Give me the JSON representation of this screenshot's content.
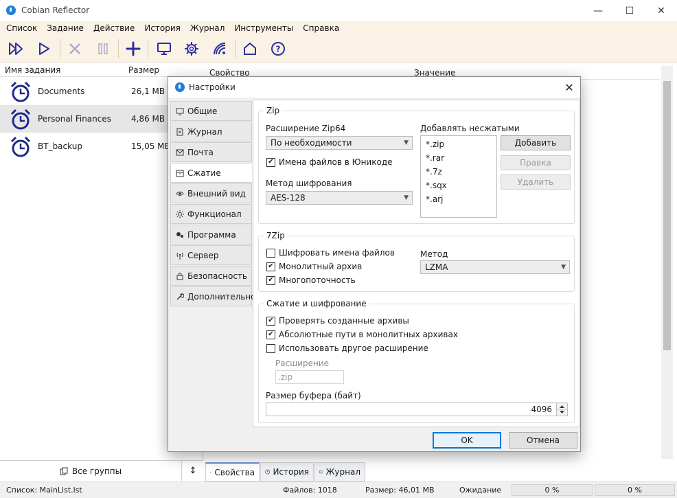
{
  "app": {
    "title": "Cobian Reflector"
  },
  "window_controls": {
    "minimize": "—",
    "maximize": "☐",
    "close": "✕"
  },
  "menu": [
    "Список",
    "Задание",
    "Действие",
    "История",
    "Журнал",
    "Инструменты",
    "Справка"
  ],
  "toolbar": {
    "icons": [
      "run-all-icon",
      "run-icon",
      "stop-icon",
      "pause-icon",
      "add-icon",
      "computer-icon",
      "settings-icon",
      "network-icon",
      "home-icon",
      "help-icon"
    ],
    "accent": "#2d2f9e"
  },
  "task_list": {
    "col_name": "Имя задания",
    "col_size": "Размер",
    "rows": [
      {
        "name": "Documents",
        "size": "26,1 MB"
      },
      {
        "name": "Personal Finances",
        "size": "4,86 MB"
      },
      {
        "name": "BT_backup",
        "size": "15,05 MB"
      }
    ],
    "group_button": "Все группы",
    "sort_icon": "↕"
  },
  "properties": {
    "col_property": "Свойство",
    "col_value": "Значение",
    "tabs": [
      "Свойства",
      "История",
      "Журнал"
    ]
  },
  "status_bar": {
    "list": "Список: MainList.lst",
    "files": "Файлов: 1018",
    "size": "Размер: 46,01 MB",
    "state": "Ожидание",
    "progress1": "0 %",
    "progress2": "0 %"
  },
  "dialog": {
    "title": "Настройки",
    "close_icon": "✕",
    "tabs": [
      {
        "label": "Общие",
        "icon": "monitor-icon"
      },
      {
        "label": "Журнал",
        "icon": "document-icon"
      },
      {
        "label": "Почта",
        "icon": "mail-icon"
      },
      {
        "label": "Сжатие",
        "icon": "archive-icon"
      },
      {
        "label": "Внешний вид",
        "icon": "eye-icon"
      },
      {
        "label": "Функционал",
        "icon": "sun-icon"
      },
      {
        "label": "Программа",
        "icon": "gears-icon"
      },
      {
        "label": "Сервер",
        "icon": "antenna-icon"
      },
      {
        "label": "Безопасность",
        "icon": "lock-icon"
      },
      {
        "label": "Дополнительно",
        "icon": "wrench-icon"
      }
    ],
    "active_tab": 3,
    "zip": {
      "group_title": "Zip",
      "zip64_label": "Расширение Zip64",
      "zip64_value": "По необходимости",
      "unicode_label": "Имена файлов в Юникоде",
      "unicode_checked": true,
      "encryption_label": "Метод шифрования",
      "encryption_value": "AES-128",
      "uncompressed_label": "Добавлять несжатыми",
      "uncompressed_items": [
        "*.zip",
        "*.rar",
        "*.7z",
        "*.sqx",
        "*.arj"
      ],
      "add_button": "Добавить",
      "edit_button": "Правка",
      "delete_button": "Удалить"
    },
    "sevenzip": {
      "group_title": "7Zip",
      "encrypt_names_label": "Шифровать имена файлов",
      "encrypt_names_checked": false,
      "solid_label": "Монолитный архив",
      "solid_checked": true,
      "multithread_label": "Многопоточность",
      "multithread_checked": true,
      "method_label": "Метод",
      "method_value": "LZMA"
    },
    "compression": {
      "group_title": "Сжатие и шифрование",
      "verify_label": "Проверять созданные архивы",
      "verify_checked": true,
      "abs_paths_label": "Абсолютные пути в монолитных архивах",
      "abs_paths_checked": true,
      "other_ext_label": "Использовать другое расширение",
      "other_ext_checked": false,
      "extension_label": "Расширение",
      "extension_value": ".zip",
      "buffer_label": "Размер буфера (байт)",
      "buffer_value": "4096"
    },
    "ok_button": "OK",
    "cancel_button": "Отмена"
  }
}
